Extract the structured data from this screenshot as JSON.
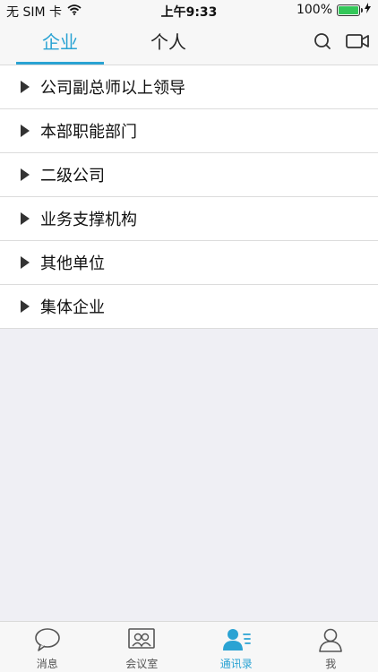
{
  "status_bar": {
    "carrier": "无 SIM 卡",
    "time": "上午9:33",
    "battery": "100%"
  },
  "top_tabs": [
    {
      "label": "企业",
      "active": true
    },
    {
      "label": "个人",
      "active": false
    }
  ],
  "list_items": [
    "公司副总师以上领导",
    "本部职能部门",
    "二级公司",
    "业务支撑机构",
    "其他单位",
    "集体企业"
  ],
  "bottom_tabs": [
    {
      "label": "消息",
      "icon": "chat-bubble-icon",
      "active": false
    },
    {
      "label": "会议室",
      "icon": "meeting-room-icon",
      "active": false
    },
    {
      "label": "通讯录",
      "icon": "contacts-icon",
      "active": true
    },
    {
      "label": "我",
      "icon": "person-icon",
      "active": false
    }
  ],
  "colors": {
    "accent": "#2aa3d3",
    "background": "#efeff4",
    "battery": "#33c759"
  }
}
